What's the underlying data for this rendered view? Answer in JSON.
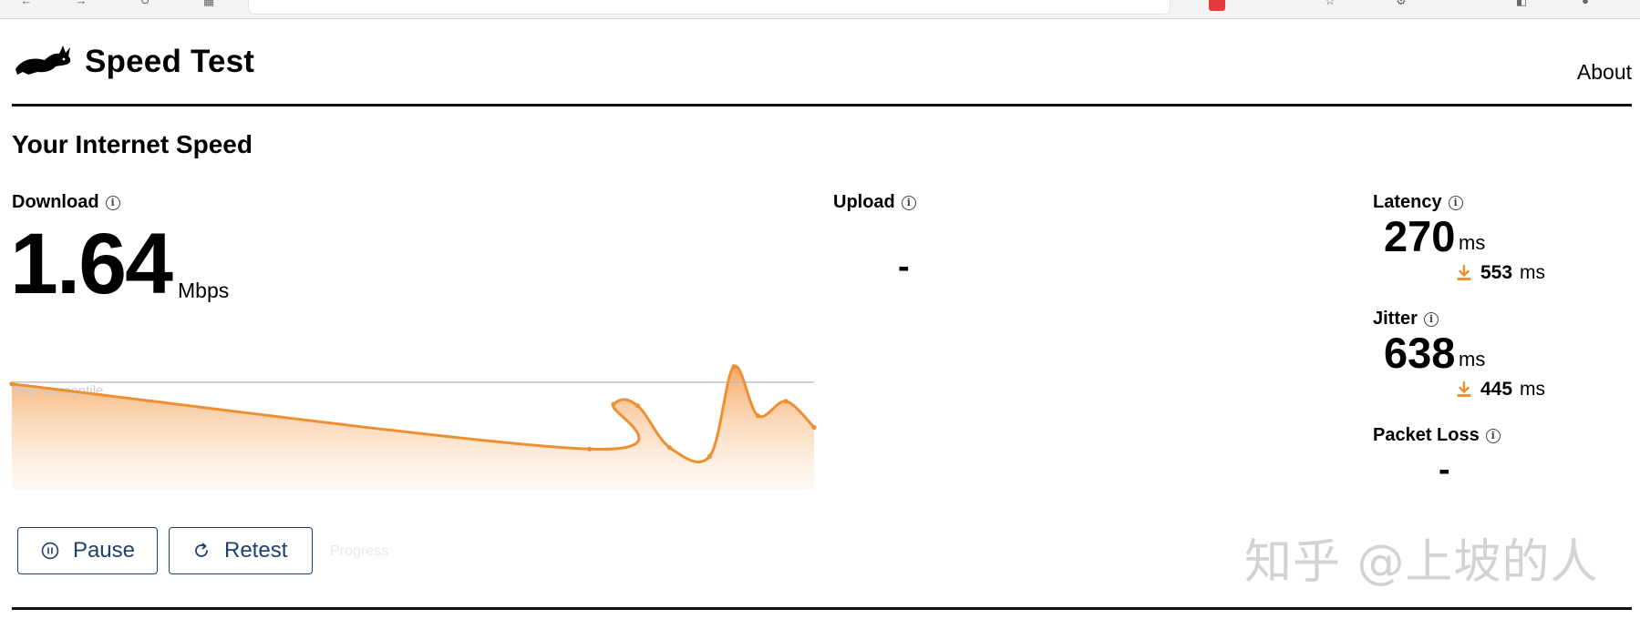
{
  "header": {
    "app_title": "Speed Test",
    "about_label": "About"
  },
  "section_title": "Your Internet Speed",
  "download": {
    "label": "Download",
    "value": "1.64",
    "unit": "Mbps",
    "percentile_label": "90th percentile"
  },
  "upload": {
    "label": "Upload",
    "value": "-"
  },
  "latency": {
    "label": "Latency",
    "value": "270",
    "unit": "ms",
    "loaded_value": "553",
    "loaded_unit": "ms"
  },
  "jitter": {
    "label": "Jitter",
    "value": "638",
    "unit": "ms",
    "loaded_value": "445",
    "loaded_unit": "ms"
  },
  "packet_loss": {
    "label": "Packet Loss",
    "value": "-"
  },
  "buttons": {
    "pause_label": "Pause",
    "retest_label": "Retest",
    "faded_label": "Progress"
  },
  "watermark": "知乎 @上坡的人",
  "colors": {
    "accent": "#ef8f34",
    "fill_top": "#f6a55c",
    "button_border": "#1f3f6e",
    "percentile_line": "#bdbdbd"
  },
  "icons": {
    "logo": "rabbit-logo-icon",
    "info": "info-icon",
    "pause": "pause-circle-icon",
    "retest": "refresh-icon",
    "download_arrow": "download-arrow-icon"
  },
  "chart_data": {
    "type": "area",
    "x": [
      0,
      0.72,
      0.75,
      0.78,
      0.82,
      0.87,
      0.9,
      0.93,
      0.965,
      1.0
    ],
    "values": [
      1.0,
      0.55,
      0.86,
      0.85,
      0.56,
      0.5,
      1.12,
      0.78,
      0.88,
      0.7
    ],
    "reference_line": {
      "label": "90th percentile",
      "value": 1.0
    }
  }
}
